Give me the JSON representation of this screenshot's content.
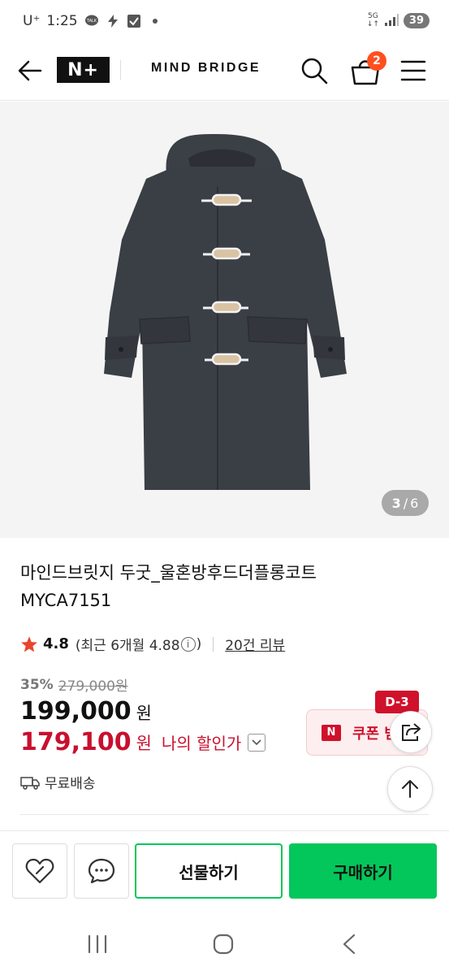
{
  "status_bar": {
    "carrier": "U⁺",
    "time": "1:25",
    "network": "5G",
    "battery": "39"
  },
  "header": {
    "logo": "N+",
    "brand": "MIND BRIDGE",
    "cart_count": "2"
  },
  "gallery": {
    "current": "3",
    "separator": "/",
    "total": "6"
  },
  "product": {
    "name_line1": "마인드브릿지 두굿_울혼방후드더플롱코트",
    "name_line2": "MYCA7151",
    "rating": "4.8",
    "recent_rating_prefix": "(최근 6개월 4.88",
    "recent_rating_suffix": ")",
    "info_symbol": "i",
    "review_count": "20건 리뷰",
    "discount_rate": "35%",
    "original_price": "279,000원",
    "price": "199,000",
    "currency": "원",
    "my_price": "179,100",
    "my_price_label": "나의 할인가",
    "shipping": "무료배송"
  },
  "coupon": {
    "dday": "D-3",
    "icon_letter": "N",
    "label": "쿠폰 받"
  },
  "bottom_bar": {
    "gift_label": "선물하기",
    "buy_label": "구매하기"
  },
  "colors": {
    "accent_green": "#03c75a",
    "sale_red": "#c8102e",
    "coupon_red": "#d0112b",
    "badge_orange": "#ff4f1f"
  }
}
